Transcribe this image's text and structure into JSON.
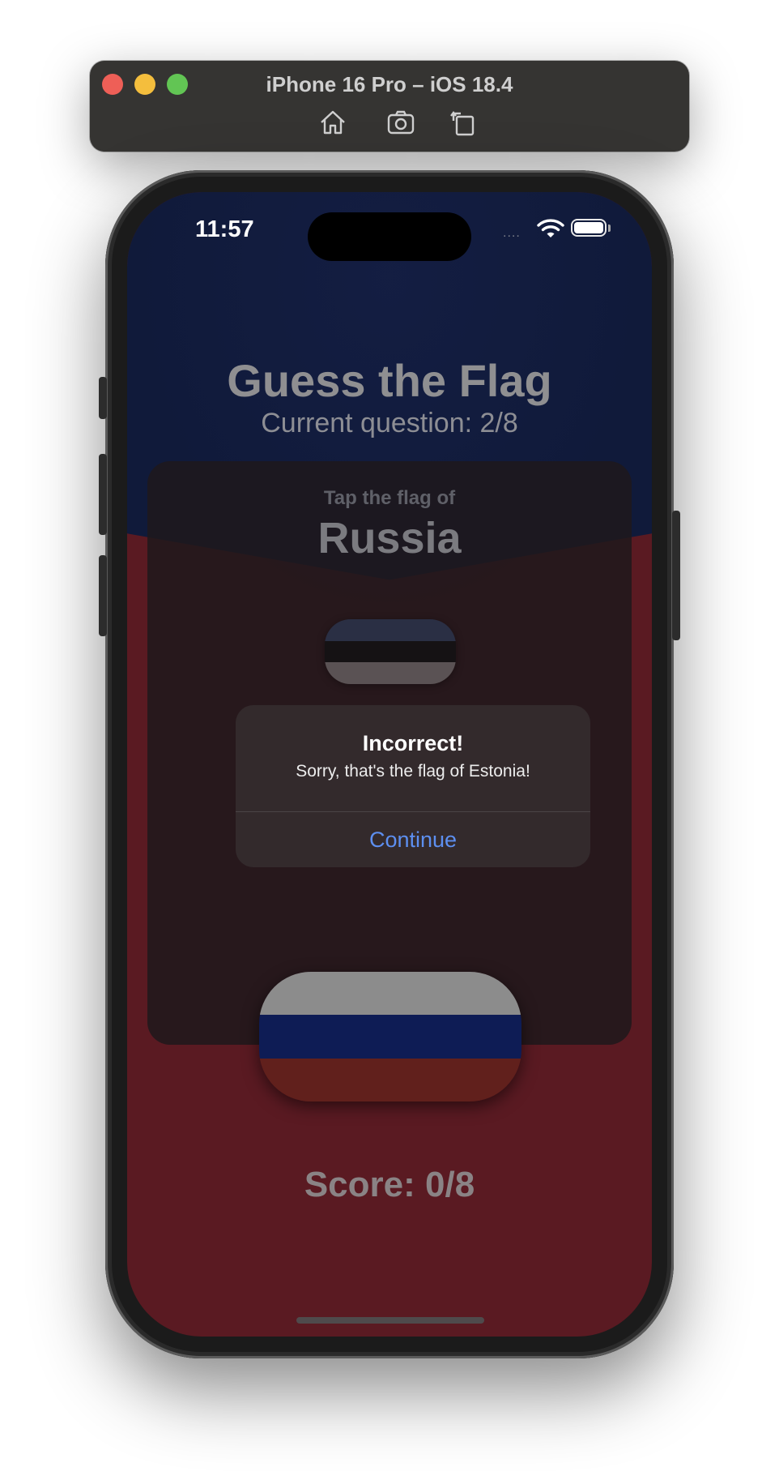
{
  "simulator": {
    "title": "iPhone 16 Pro – iOS 18.4",
    "toolbar_icons": [
      "home-icon",
      "screenshot-icon",
      "rotate-icon"
    ]
  },
  "status_bar": {
    "time": "11:57",
    "signal": "....",
    "wifi_icon": "wifi-icon",
    "battery_icon": "battery-icon"
  },
  "header": {
    "title": "Guess the Flag",
    "question": "Current question: 2/8"
  },
  "card": {
    "prompt": "Tap the flag of",
    "country": "Russia"
  },
  "flags": [
    {
      "name": "flag-estonia",
      "stripes": [
        "#2a2f44",
        "#151214",
        "#5a5254"
      ]
    },
    {
      "name": "flag-russia",
      "stripes": [
        "#8c8c8c",
        "#0e1c55",
        "#61201c"
      ]
    }
  ],
  "alert": {
    "title": "Incorrect!",
    "message": "Sorry, that's the flag of Estonia!",
    "button": "Continue",
    "button_color": "#5d8ff0"
  },
  "footer": {
    "score": "Score: 0/8"
  },
  "colors": {
    "top_background": "#101a3a",
    "bottom_background": "#5a1a22"
  }
}
